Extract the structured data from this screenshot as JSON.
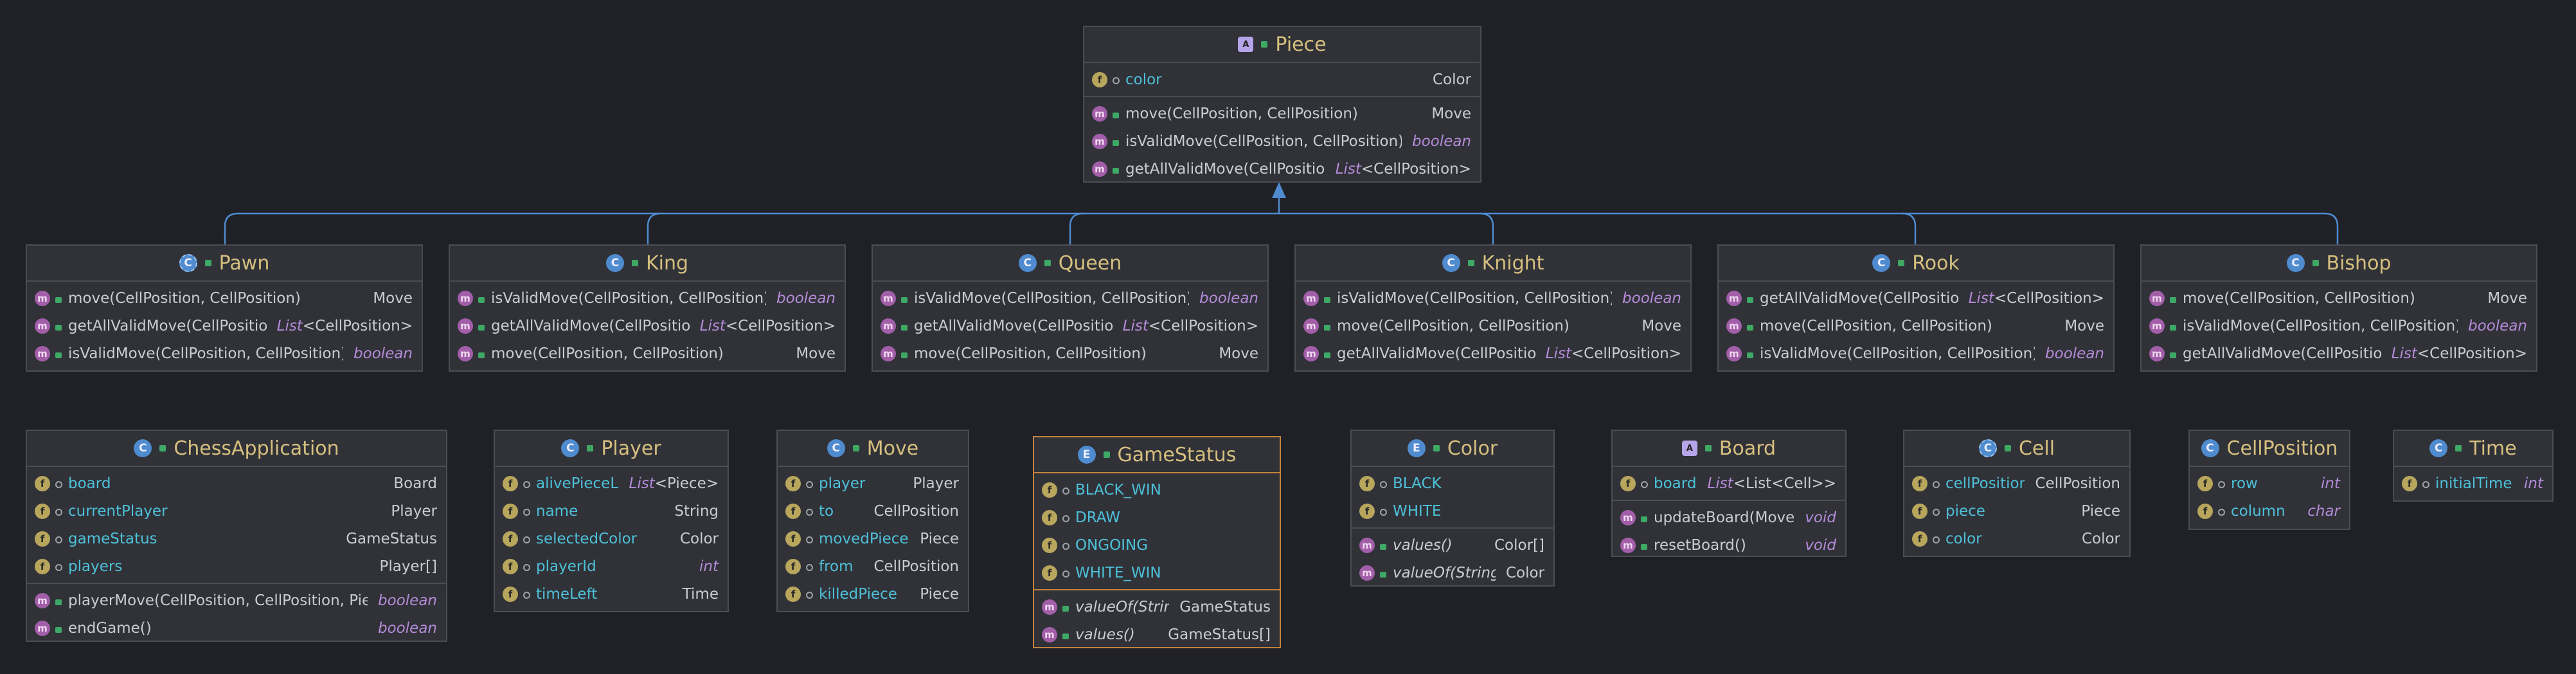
{
  "classes": {
    "piece": {
      "title": "Piece",
      "kind": "abstract",
      "fields": [
        {
          "name": "color",
          "type": "Color"
        }
      ],
      "methods": [
        {
          "name": "move(CellPosition, CellPosition)",
          "type": "Move"
        },
        {
          "name": "isValidMove(CellPosition, CellPosition)",
          "type": "boolean"
        },
        {
          "name": "getAllValidMove(CellPosition)",
          "type_kw": "List",
          "type_rest": "<CellPosition>"
        }
      ]
    },
    "pawn": {
      "title": "Pawn",
      "kind": "class",
      "methods": [
        {
          "name": "move(CellPosition, CellPosition)",
          "type": "Move"
        },
        {
          "name": "getAllValidMove(CellPosition)",
          "type_kw": "List",
          "type_rest": "<CellPosition>"
        },
        {
          "name": "isValidMove(CellPosition, CellPosition)",
          "type": "boolean"
        }
      ]
    },
    "king": {
      "title": "King",
      "kind": "class",
      "methods": [
        {
          "name": "isValidMove(CellPosition, CellPosition)",
          "type": "boolean"
        },
        {
          "name": "getAllValidMove(CellPosition)",
          "type_kw": "List",
          "type_rest": "<CellPosition>"
        },
        {
          "name": "move(CellPosition, CellPosition)",
          "type": "Move"
        }
      ]
    },
    "queen": {
      "title": "Queen",
      "kind": "class",
      "methods": [
        {
          "name": "isValidMove(CellPosition, CellPosition)",
          "type": "boolean"
        },
        {
          "name": "getAllValidMove(CellPosition)",
          "type_kw": "List",
          "type_rest": "<CellPosition>"
        },
        {
          "name": "move(CellPosition, CellPosition)",
          "type": "Move"
        }
      ]
    },
    "knight": {
      "title": "Knight",
      "kind": "class",
      "methods": [
        {
          "name": "isValidMove(CellPosition, CellPosition)",
          "type": "boolean"
        },
        {
          "name": "move(CellPosition, CellPosition)",
          "type": "Move"
        },
        {
          "name": "getAllValidMove(CellPosition)",
          "type_kw": "List",
          "type_rest": "<CellPosition>"
        }
      ]
    },
    "rook": {
      "title": "Rook",
      "kind": "class",
      "methods": [
        {
          "name": "getAllValidMove(CellPosition)",
          "type_kw": "List",
          "type_rest": "<CellPosition>"
        },
        {
          "name": "move(CellPosition, CellPosition)",
          "type": "Move"
        },
        {
          "name": "isValidMove(CellPosition, CellPosition)",
          "type": "boolean"
        }
      ]
    },
    "bishop": {
      "title": "Bishop",
      "kind": "class",
      "methods": [
        {
          "name": "move(CellPosition, CellPosition)",
          "type": "Move"
        },
        {
          "name": "isValidMove(CellPosition, CellPosition)",
          "type": "boolean"
        },
        {
          "name": "getAllValidMove(CellPosition)",
          "type_kw": "List",
          "type_rest": "<CellPosition>"
        }
      ]
    },
    "chessApplication": {
      "title": "ChessApplication",
      "kind": "class",
      "fields": [
        {
          "name": "board",
          "type": "Board"
        },
        {
          "name": "currentPlayer",
          "type": "Player"
        },
        {
          "name": "gameStatus",
          "type": "GameStatus"
        },
        {
          "name": "players",
          "type": "Player[]"
        }
      ],
      "methods": [
        {
          "name": "playerMove(CellPosition, CellPosition, Piece)",
          "type": "boolean"
        },
        {
          "name": "endGame()",
          "type": "boolean"
        }
      ]
    },
    "player": {
      "title": "Player",
      "kind": "class",
      "fields": [
        {
          "name": "alivePieceList",
          "type_kw": "List",
          "type_rest": "<Piece>"
        },
        {
          "name": "name",
          "type": "String"
        },
        {
          "name": "selectedColor",
          "type": "Color"
        },
        {
          "name": "playerId",
          "type": "int"
        },
        {
          "name": "timeLeft",
          "type": "Time"
        }
      ]
    },
    "move": {
      "title": "Move",
      "kind": "class",
      "fields": [
        {
          "name": "player",
          "type": "Player"
        },
        {
          "name": "to",
          "type": "CellPosition"
        },
        {
          "name": "movedPiece",
          "type": "Piece"
        },
        {
          "name": "from",
          "type": "CellPosition"
        },
        {
          "name": "killedPiece",
          "type": "Piece"
        }
      ]
    },
    "gameStatus": {
      "title": "GameStatus",
      "kind": "enum",
      "fields": [
        {
          "name": "BLACK_WIN",
          "type": ""
        },
        {
          "name": "DRAW",
          "type": ""
        },
        {
          "name": "ONGOING",
          "type": ""
        },
        {
          "name": "WHITE_WIN",
          "type": ""
        }
      ],
      "methods": [
        {
          "name": "valueOf(String)",
          "type": "GameStatus",
          "italic": true
        },
        {
          "name": "values()",
          "type": "GameStatus[]",
          "italic": true
        }
      ]
    },
    "color": {
      "title": "Color",
      "kind": "enum",
      "fields": [
        {
          "name": "BLACK",
          "type": ""
        },
        {
          "name": "WHITE",
          "type": ""
        }
      ],
      "methods": [
        {
          "name": "values()",
          "type": "Color[]",
          "italic": true
        },
        {
          "name": "valueOf(String)",
          "type": "Color",
          "italic": true
        }
      ]
    },
    "board": {
      "title": "Board",
      "kind": "abstract",
      "fields": [
        {
          "name": "board",
          "type_kw": "List",
          "type_rest": "<List<Cell>>"
        }
      ],
      "methods": [
        {
          "name": "updateBoard(Move)",
          "type": "void"
        },
        {
          "name": "resetBoard()",
          "type": "void"
        }
      ]
    },
    "cell": {
      "title": "Cell",
      "kind": "class",
      "fields": [
        {
          "name": "cellPosition",
          "type": "CellPosition"
        },
        {
          "name": "piece",
          "type": "Piece"
        },
        {
          "name": "color",
          "type": "Color"
        }
      ]
    },
    "cellPosition": {
      "title": "CellPosition",
      "kind": "class",
      "fields": [
        {
          "name": "row",
          "type": "int"
        },
        {
          "name": "column",
          "type": "char"
        }
      ]
    },
    "time": {
      "title": "Time",
      "kind": "class",
      "fields": [
        {
          "name": "initialTime",
          "type": "int"
        }
      ]
    }
  },
  "keywords": [
    "boolean",
    "int",
    "char",
    "void"
  ],
  "colors": {
    "edge": "#4f8bcf",
    "background": "#1f2127",
    "panel": "#303238",
    "enum_border": "#c5823e"
  }
}
